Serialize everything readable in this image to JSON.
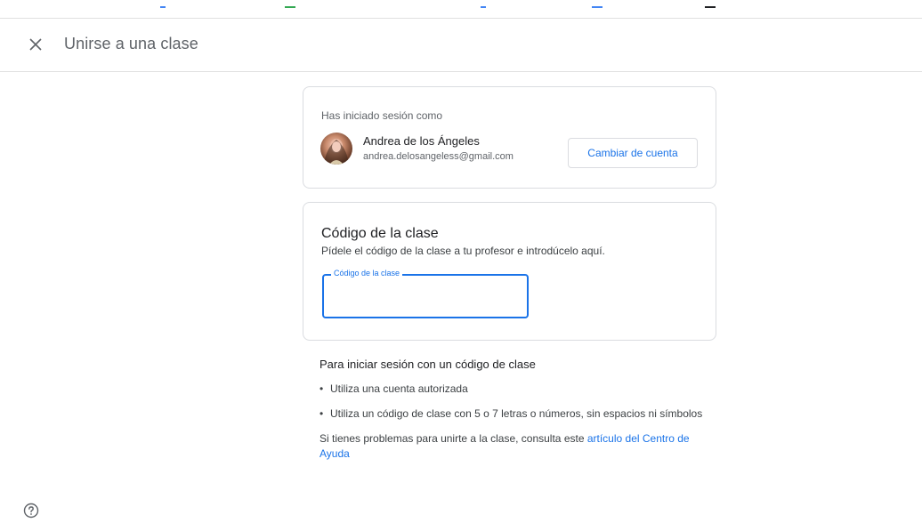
{
  "header": {
    "title": "Unirse a una clase",
    "close_icon": "close-icon"
  },
  "account": {
    "signed_in_label": "Has iniciado sesión como",
    "name": "Andrea de los Ángeles",
    "email": "andrea.delosangeless@gmail.com",
    "switch_button": "Cambiar de cuenta"
  },
  "class_code": {
    "title": "Código de la clase",
    "subtitle": "Pídele el código de la clase a tu profesor e introdúcelo aquí.",
    "field_label": "Código de la clase",
    "value": ""
  },
  "info": {
    "heading": "Para iniciar sesión con un código de clase",
    "bullets": [
      "Utiliza una cuenta autorizada",
      "Utiliza un código de clase con 5 o 7 letras o números, sin espacios ni símbolos"
    ],
    "help_prefix": "Si tienes problemas para unirte a la clase, consulta este ",
    "help_link": "artículo del Centro de Ayuda"
  },
  "colors": {
    "accent": "#1a73e8",
    "border": "#dadce0",
    "text": "#3c4043"
  }
}
